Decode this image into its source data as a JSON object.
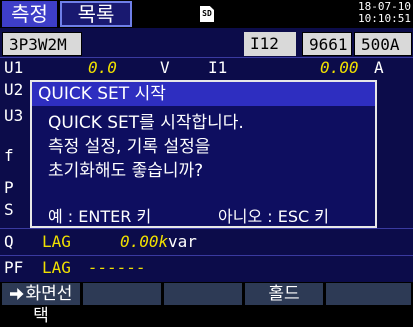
{
  "tabs": [
    {
      "label": "측정"
    },
    {
      "label": "목록"
    }
  ],
  "status": {
    "sd_icon": "SD",
    "date": "18-07-10",
    "time": "10:10:51"
  },
  "info_row": {
    "wiring": "3P3W2M",
    "channel": "I12",
    "clamp": "9661",
    "range": "500A"
  },
  "measurements": {
    "left_labels": [
      "U1",
      "U2",
      "U3",
      "f",
      "P",
      "S",
      "Q",
      "PF"
    ],
    "q_row": {
      "label": "Q",
      "lag": "LAG",
      "value": "0.00k",
      "unit": "var"
    },
    "pf_row": {
      "label": "PF",
      "lag": "LAG",
      "value": "------"
    },
    "u1_value": "0.0",
    "u1_unit": "V",
    "i1_label": "I1",
    "i1_value": "0.00",
    "i1_unit": "A"
  },
  "dialog": {
    "title": "QUICK SET 시작",
    "lines": [
      "QUICK SET를 시작합니다.",
      "측정 설정, 기록 설정을",
      "초기화해도 좋습니까?"
    ],
    "yes_text": "예 : ENTER 키",
    "no_text": "아니오 : ESC 키"
  },
  "function_keys": [
    {
      "label": "화면선택",
      "icon": "screen-select-arrow-icon"
    },
    {
      "label": ""
    },
    {
      "label": ""
    },
    {
      "label": "홀드"
    },
    {
      "label": ""
    }
  ],
  "colors": {
    "background": "#0c0c4a",
    "value_yellow": "#f0e000",
    "dialog_title": "#2e2ec0",
    "tab_active": "#3e3ec8"
  }
}
